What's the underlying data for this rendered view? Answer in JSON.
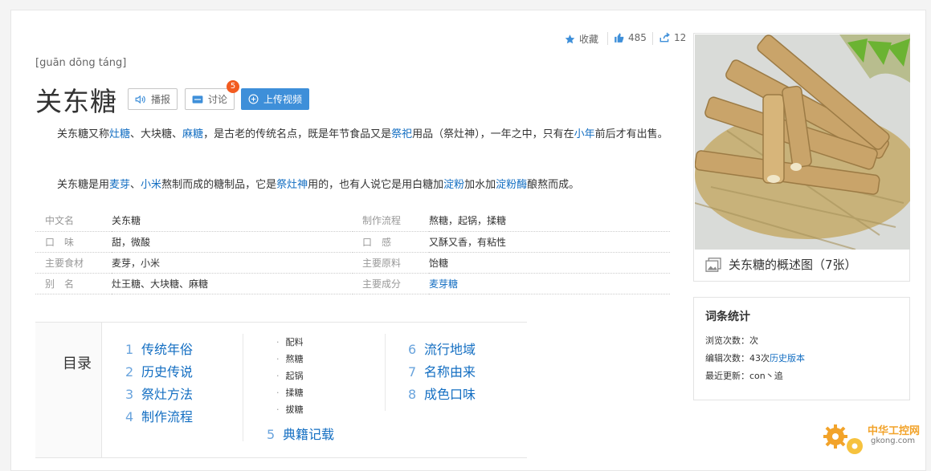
{
  "header": {
    "pinyin": "[guān dōng táng]",
    "title": "关东糖",
    "buttons": {
      "broadcast": "播报",
      "discuss": "讨论",
      "discuss_badge": "5",
      "upload": "上传视频"
    },
    "actions": {
      "favorite": "收藏",
      "like_count": "485",
      "share_count": "12"
    }
  },
  "intro": {
    "p1": [
      {
        "t": "关东糖又称"
      },
      {
        "t": "灶糖",
        "link": true
      },
      {
        "t": "、大块糖、"
      },
      {
        "t": "麻糖",
        "link": true
      },
      {
        "t": "，是古老的传统名点，既是年节食品又是"
      },
      {
        "t": "祭祀",
        "link": true
      },
      {
        "t": "用品（祭灶神），一年之中，只有在"
      },
      {
        "t": "小年",
        "link": true
      },
      {
        "t": "前后才有出售。"
      }
    ],
    "p2": [
      {
        "t": "关东糖是用"
      },
      {
        "t": "麦芽",
        "link": true
      },
      {
        "t": "、"
      },
      {
        "t": "小米",
        "link": true
      },
      {
        "t": "熬制而成的糖制品，它是"
      },
      {
        "t": "祭灶神",
        "link": true
      },
      {
        "t": "用的，也有人说它是用白糖加"
      },
      {
        "t": "淀粉",
        "link": true
      },
      {
        "t": "加水加"
      },
      {
        "t": "淀粉酶",
        "link": true
      },
      {
        "t": "酿熬而成。"
      }
    ]
  },
  "infobox": {
    "rows": [
      {
        "k1": "中文名",
        "v1": "关东糖",
        "k2": "制作流程",
        "v2": "熬糖，起锅，揉糖"
      },
      {
        "k1": "口　味",
        "v1": "甜，微酸",
        "k2": "口　感",
        "v2": "又酥又香，有粘性"
      },
      {
        "k1": "主要食材",
        "v1": "麦芽，小米",
        "k2": "主要原料",
        "v2": "饴糖"
      },
      {
        "k1": "别　名",
        "v1": "灶王糖、大块糖、麻糖",
        "k2": "主要成分",
        "v2": "麦芽糖"
      }
    ]
  },
  "toc": {
    "label": "目录",
    "col1": [
      {
        "num": "1",
        "label": "传统年俗"
      },
      {
        "num": "2",
        "label": "历史传说"
      },
      {
        "num": "3",
        "label": "祭灶方法"
      },
      {
        "num": "4",
        "label": "制作流程"
      }
    ],
    "subs": [
      "配料",
      "熬糖",
      "起锅",
      "揉糖",
      "拔糖"
    ],
    "col3": [
      {
        "num": "6",
        "label": "流行地域"
      },
      {
        "num": "7",
        "label": "名称由来"
      },
      {
        "num": "8",
        "label": "成色口味"
      }
    ],
    "item5": {
      "num": "5",
      "label": "典籍记载"
    }
  },
  "album": {
    "caption": "关东糖的概述图（7张）"
  },
  "stats": {
    "title": "词条统计",
    "views": "浏览次数：次",
    "edits_prefix": "编辑次数：43次",
    "history_link": "历史版本",
    "last_update": "最近更新：con丶追"
  },
  "watermark": {
    "cn": "中华工控网",
    "url": "gkong.com"
  },
  "colors": {
    "link": "#136ec2",
    "accent": "#3e8fd9",
    "badge": "#f25b20"
  }
}
